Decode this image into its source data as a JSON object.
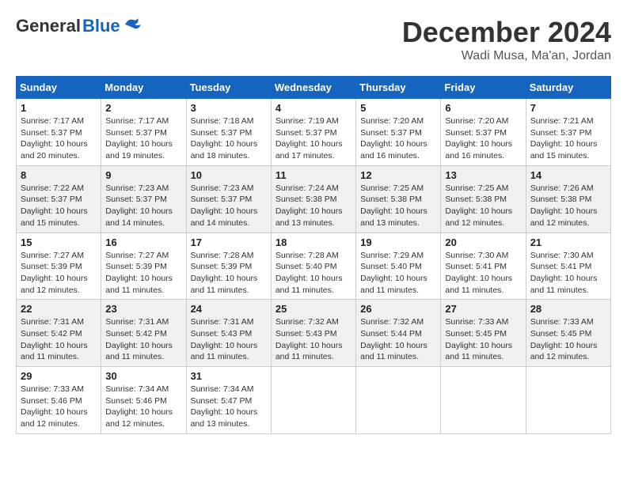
{
  "header": {
    "logo_general": "General",
    "logo_blue": "Blue",
    "month_title": "December 2024",
    "location": "Wadi Musa, Ma'an, Jordan"
  },
  "days_of_week": [
    "Sunday",
    "Monday",
    "Tuesday",
    "Wednesday",
    "Thursday",
    "Friday",
    "Saturday"
  ],
  "weeks": [
    [
      {
        "day": "1",
        "sunrise": "Sunrise: 7:17 AM",
        "sunset": "Sunset: 5:37 PM",
        "daylight": "Daylight: 10 hours and 20 minutes."
      },
      {
        "day": "2",
        "sunrise": "Sunrise: 7:17 AM",
        "sunset": "Sunset: 5:37 PM",
        "daylight": "Daylight: 10 hours and 19 minutes."
      },
      {
        "day": "3",
        "sunrise": "Sunrise: 7:18 AM",
        "sunset": "Sunset: 5:37 PM",
        "daylight": "Daylight: 10 hours and 18 minutes."
      },
      {
        "day": "4",
        "sunrise": "Sunrise: 7:19 AM",
        "sunset": "Sunset: 5:37 PM",
        "daylight": "Daylight: 10 hours and 17 minutes."
      },
      {
        "day": "5",
        "sunrise": "Sunrise: 7:20 AM",
        "sunset": "Sunset: 5:37 PM",
        "daylight": "Daylight: 10 hours and 16 minutes."
      },
      {
        "day": "6",
        "sunrise": "Sunrise: 7:20 AM",
        "sunset": "Sunset: 5:37 PM",
        "daylight": "Daylight: 10 hours and 16 minutes."
      },
      {
        "day": "7",
        "sunrise": "Sunrise: 7:21 AM",
        "sunset": "Sunset: 5:37 PM",
        "daylight": "Daylight: 10 hours and 15 minutes."
      }
    ],
    [
      {
        "day": "8",
        "sunrise": "Sunrise: 7:22 AM",
        "sunset": "Sunset: 5:37 PM",
        "daylight": "Daylight: 10 hours and 15 minutes."
      },
      {
        "day": "9",
        "sunrise": "Sunrise: 7:23 AM",
        "sunset": "Sunset: 5:37 PM",
        "daylight": "Daylight: 10 hours and 14 minutes."
      },
      {
        "day": "10",
        "sunrise": "Sunrise: 7:23 AM",
        "sunset": "Sunset: 5:37 PM",
        "daylight": "Daylight: 10 hours and 14 minutes."
      },
      {
        "day": "11",
        "sunrise": "Sunrise: 7:24 AM",
        "sunset": "Sunset: 5:38 PM",
        "daylight": "Daylight: 10 hours and 13 minutes."
      },
      {
        "day": "12",
        "sunrise": "Sunrise: 7:25 AM",
        "sunset": "Sunset: 5:38 PM",
        "daylight": "Daylight: 10 hours and 13 minutes."
      },
      {
        "day": "13",
        "sunrise": "Sunrise: 7:25 AM",
        "sunset": "Sunset: 5:38 PM",
        "daylight": "Daylight: 10 hours and 12 minutes."
      },
      {
        "day": "14",
        "sunrise": "Sunrise: 7:26 AM",
        "sunset": "Sunset: 5:38 PM",
        "daylight": "Daylight: 10 hours and 12 minutes."
      }
    ],
    [
      {
        "day": "15",
        "sunrise": "Sunrise: 7:27 AM",
        "sunset": "Sunset: 5:39 PM",
        "daylight": "Daylight: 10 hours and 12 minutes."
      },
      {
        "day": "16",
        "sunrise": "Sunrise: 7:27 AM",
        "sunset": "Sunset: 5:39 PM",
        "daylight": "Daylight: 10 hours and 11 minutes."
      },
      {
        "day": "17",
        "sunrise": "Sunrise: 7:28 AM",
        "sunset": "Sunset: 5:39 PM",
        "daylight": "Daylight: 10 hours and 11 minutes."
      },
      {
        "day": "18",
        "sunrise": "Sunrise: 7:28 AM",
        "sunset": "Sunset: 5:40 PM",
        "daylight": "Daylight: 10 hours and 11 minutes."
      },
      {
        "day": "19",
        "sunrise": "Sunrise: 7:29 AM",
        "sunset": "Sunset: 5:40 PM",
        "daylight": "Daylight: 10 hours and 11 minutes."
      },
      {
        "day": "20",
        "sunrise": "Sunrise: 7:30 AM",
        "sunset": "Sunset: 5:41 PM",
        "daylight": "Daylight: 10 hours and 11 minutes."
      },
      {
        "day": "21",
        "sunrise": "Sunrise: 7:30 AM",
        "sunset": "Sunset: 5:41 PM",
        "daylight": "Daylight: 10 hours and 11 minutes."
      }
    ],
    [
      {
        "day": "22",
        "sunrise": "Sunrise: 7:31 AM",
        "sunset": "Sunset: 5:42 PM",
        "daylight": "Daylight: 10 hours and 11 minutes."
      },
      {
        "day": "23",
        "sunrise": "Sunrise: 7:31 AM",
        "sunset": "Sunset: 5:42 PM",
        "daylight": "Daylight: 10 hours and 11 minutes."
      },
      {
        "day": "24",
        "sunrise": "Sunrise: 7:31 AM",
        "sunset": "Sunset: 5:43 PM",
        "daylight": "Daylight: 10 hours and 11 minutes."
      },
      {
        "day": "25",
        "sunrise": "Sunrise: 7:32 AM",
        "sunset": "Sunset: 5:43 PM",
        "daylight": "Daylight: 10 hours and 11 minutes."
      },
      {
        "day": "26",
        "sunrise": "Sunrise: 7:32 AM",
        "sunset": "Sunset: 5:44 PM",
        "daylight": "Daylight: 10 hours and 11 minutes."
      },
      {
        "day": "27",
        "sunrise": "Sunrise: 7:33 AM",
        "sunset": "Sunset: 5:45 PM",
        "daylight": "Daylight: 10 hours and 11 minutes."
      },
      {
        "day": "28",
        "sunrise": "Sunrise: 7:33 AM",
        "sunset": "Sunset: 5:45 PM",
        "daylight": "Daylight: 10 hours and 12 minutes."
      }
    ],
    [
      {
        "day": "29",
        "sunrise": "Sunrise: 7:33 AM",
        "sunset": "Sunset: 5:46 PM",
        "daylight": "Daylight: 10 hours and 12 minutes."
      },
      {
        "day": "30",
        "sunrise": "Sunrise: 7:34 AM",
        "sunset": "Sunset: 5:46 PM",
        "daylight": "Daylight: 10 hours and 12 minutes."
      },
      {
        "day": "31",
        "sunrise": "Sunrise: 7:34 AM",
        "sunset": "Sunset: 5:47 PM",
        "daylight": "Daylight: 10 hours and 13 minutes."
      },
      null,
      null,
      null,
      null
    ]
  ]
}
